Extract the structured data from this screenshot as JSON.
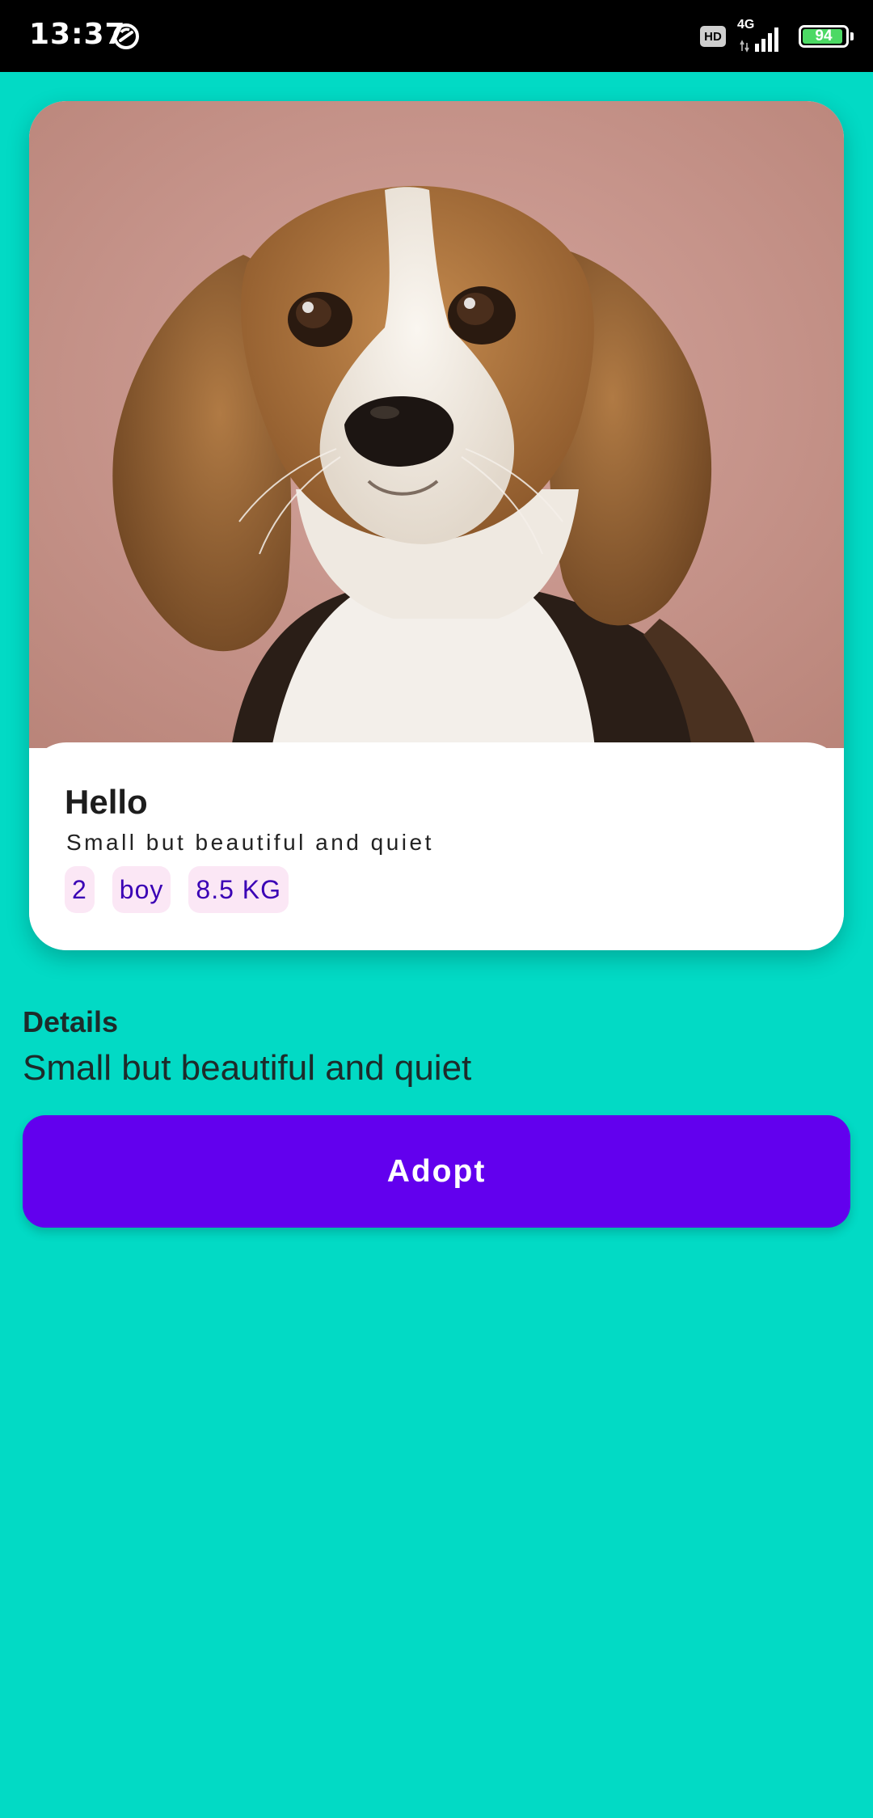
{
  "status_bar": {
    "time": "13:37",
    "sync_icon": "sync-circle-icon",
    "hd_label": "HD",
    "network_label": "4G",
    "signal_icon": "signal-bars-icon",
    "battery_level": 94,
    "battery_label": "94",
    "battery_color": "#4CD964"
  },
  "pet_card": {
    "photo_icon": "beagle-puppy-photo",
    "name": "Hello",
    "tagline": "Small but beautiful and quiet",
    "chips": [
      "2",
      "boy",
      "8.5 KG"
    ]
  },
  "details": {
    "title": "Details",
    "text": "Small but beautiful and quiet"
  },
  "actions": {
    "adopt_label": "Adopt"
  },
  "colors": {
    "background": "#02DAC5",
    "accent": "#6200EE",
    "chip_bg": "#FBE7F5",
    "chip_text": "#3A00B5"
  }
}
